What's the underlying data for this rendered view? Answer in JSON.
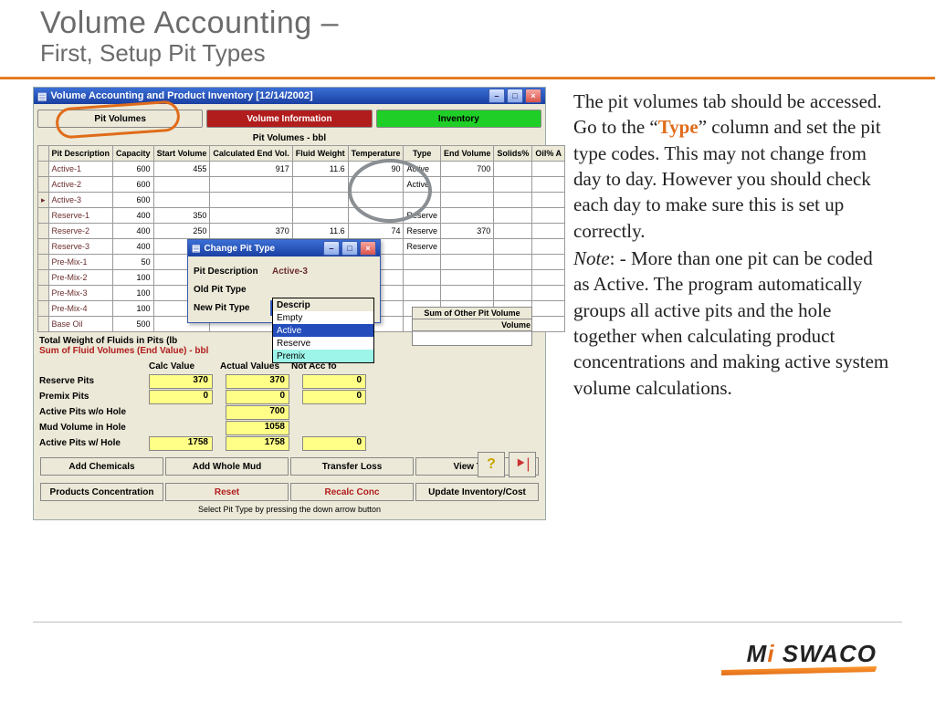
{
  "header": {
    "title": "Volume Accounting –",
    "subtitle": "First, Setup Pit Types"
  },
  "rhs": {
    "p1a": "The pit volumes tab should be accessed.  Go to the “",
    "type_word": "Type",
    "p1b": "” column and set the pit type codes.  This may not change from day to day.  However you should check each day to make sure this is set up correctly.",
    "note_label": "Note",
    "p2": ": - More than one pit can be coded as Active.  The program automatically groups all active pits and the hole together when calculating product concentrations and making active system volume calculations."
  },
  "logo": {
    "text_a": "M",
    "text_i": "i",
    "text_b": " SWACO"
  },
  "win": {
    "title": "Volume Accounting and Product Inventory [12/14/2002]",
    "tabs": {
      "pit_volumes": "Pit Volumes",
      "volume_info": "Volume Information",
      "inventory": "Inventory"
    },
    "section_title": "Pit Volumes - bbl",
    "cols": [
      "Pit Description",
      "Capacity",
      "Start Volume",
      "Calculated End Vol.",
      "Fluid Weight",
      "Temperature",
      "Type",
      "End Volume",
      "Solids%",
      "Oil% A"
    ],
    "rows": [
      {
        "desc": "Active-1",
        "cap": "600",
        "sv": "455",
        "cev": "917",
        "fw": "11.6",
        "temp": "90",
        "type": "Active",
        "ev": "700"
      },
      {
        "desc": "Active-2",
        "cap": "600",
        "sv": "",
        "cev": "",
        "fw": "",
        "temp": "",
        "type": "Active",
        "ev": ""
      },
      {
        "desc": "Active-3",
        "cap": "600",
        "sv": "",
        "cev": "",
        "fw": "",
        "temp": "",
        "type": "",
        "ev": ""
      },
      {
        "desc": "Reserve-1",
        "cap": "400",
        "sv": "350",
        "cev": "",
        "fw": "",
        "temp": "",
        "type": "Reserve",
        "ev": ""
      },
      {
        "desc": "Reserve-2",
        "cap": "400",
        "sv": "250",
        "cev": "370",
        "fw": "11.6",
        "temp": "74",
        "type": "Reserve",
        "ev": "370"
      },
      {
        "desc": "Reserve-3",
        "cap": "400",
        "sv": "",
        "cev": "",
        "fw": "",
        "temp": "",
        "type": "Reserve",
        "ev": ""
      },
      {
        "desc": "Pre-Mix-1",
        "cap": "50",
        "sv": "",
        "cev": "",
        "fw": "",
        "temp": "",
        "type": "",
        "ev": ""
      },
      {
        "desc": "Pre-Mix-2",
        "cap": "100",
        "sv": "",
        "cev": "",
        "fw": "",
        "temp": "",
        "type": "",
        "ev": ""
      },
      {
        "desc": "Pre-Mix-3",
        "cap": "100",
        "sv": "",
        "cev": "",
        "fw": "",
        "temp": "",
        "type": "",
        "ev": ""
      },
      {
        "desc": "Pre-Mix-4",
        "cap": "100",
        "sv": "",
        "cev": "",
        "fw": "",
        "temp": "",
        "type": "",
        "ev": ""
      },
      {
        "desc": "Base Oil",
        "cap": "500",
        "sv": "",
        "cev": "",
        "fw": "",
        "temp": "",
        "type": "",
        "ev": ""
      }
    ],
    "total_weight_label": "Total Weight of Fluids in Pits (lb",
    "sum_label": "Sum of Fluid Volumes (End Value) - bbl",
    "calc_headers": {
      "calc": "Calc Value",
      "actual": "Actual Values",
      "notacc": "Not Acc fo"
    },
    "calcs": [
      {
        "lbl": "Reserve Pits",
        "c": "370",
        "a": "370",
        "n": "0"
      },
      {
        "lbl": "Premix Pits",
        "c": "0",
        "a": "0",
        "n": "0"
      },
      {
        "lbl": "Active Pits w/o Hole",
        "c": "",
        "a": "700",
        "n": ""
      },
      {
        "lbl": "Mud Volume in Hole",
        "c": "",
        "a": "1058",
        "n": ""
      },
      {
        "lbl": "Active Pits w/ Hole",
        "c": "1758",
        "a": "1758",
        "n": "0"
      }
    ],
    "btns": {
      "add_chem": "Add Chemicals",
      "add_mud": "Add Whole Mud",
      "transfer": "Transfer Loss",
      "view": "View Trans",
      "prod": "Products Concentration",
      "reset": "Reset",
      "recalc": "Recalc Conc",
      "update": "Update Inventory/Cost"
    },
    "hint": "Select Pit Type by pressing the down arrow button",
    "sov": {
      "title": "Sum of Other Pit Volume",
      "col": "Volume"
    },
    "icons": {
      "help": "?",
      "exit": "⎋"
    }
  },
  "dlg": {
    "title": "Change Pit Type",
    "pit_desc_lbl": "Pit Description",
    "pit_desc_val": "Active-3",
    "old_lbl": "Old Pit Type",
    "old_val": "",
    "new_lbl": "New Pit Type",
    "new_val": "Active",
    "options": [
      "Descrip",
      "Empty",
      "Active",
      "Reserve",
      "Premix"
    ]
  }
}
